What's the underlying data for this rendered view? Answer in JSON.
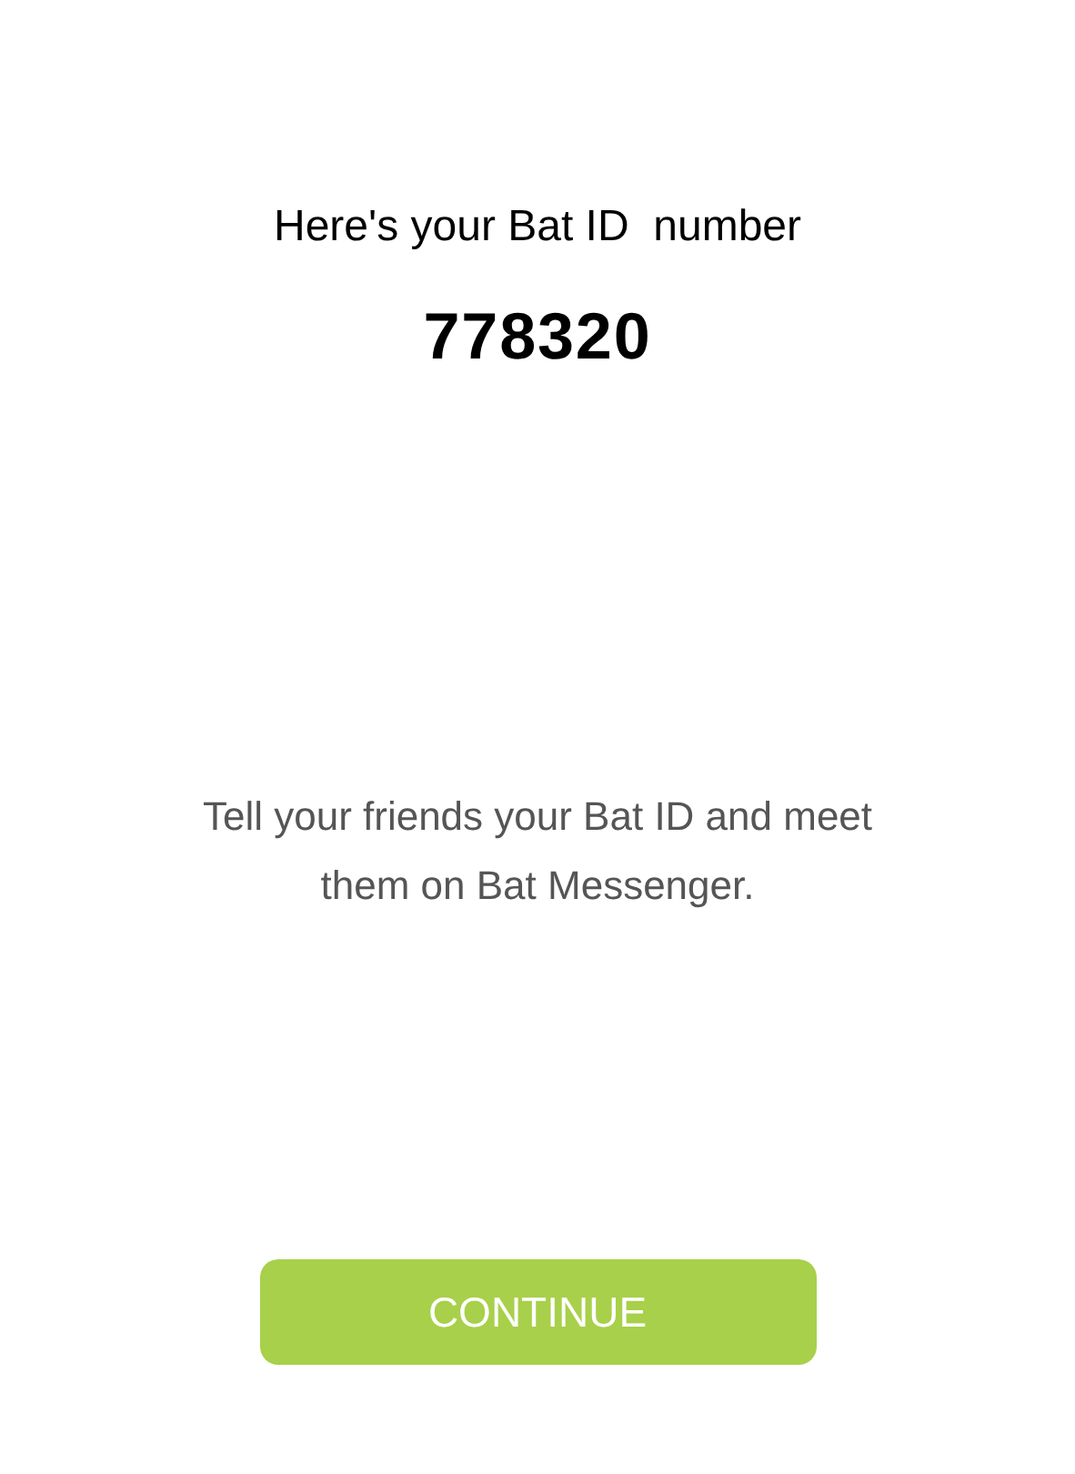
{
  "heading": "Here's your Bat ID  number",
  "id_number": "778320",
  "message": "Tell your friends your Bat ID and meet them on Bat Messenger.",
  "button": {
    "label": "CONTINUE"
  }
}
